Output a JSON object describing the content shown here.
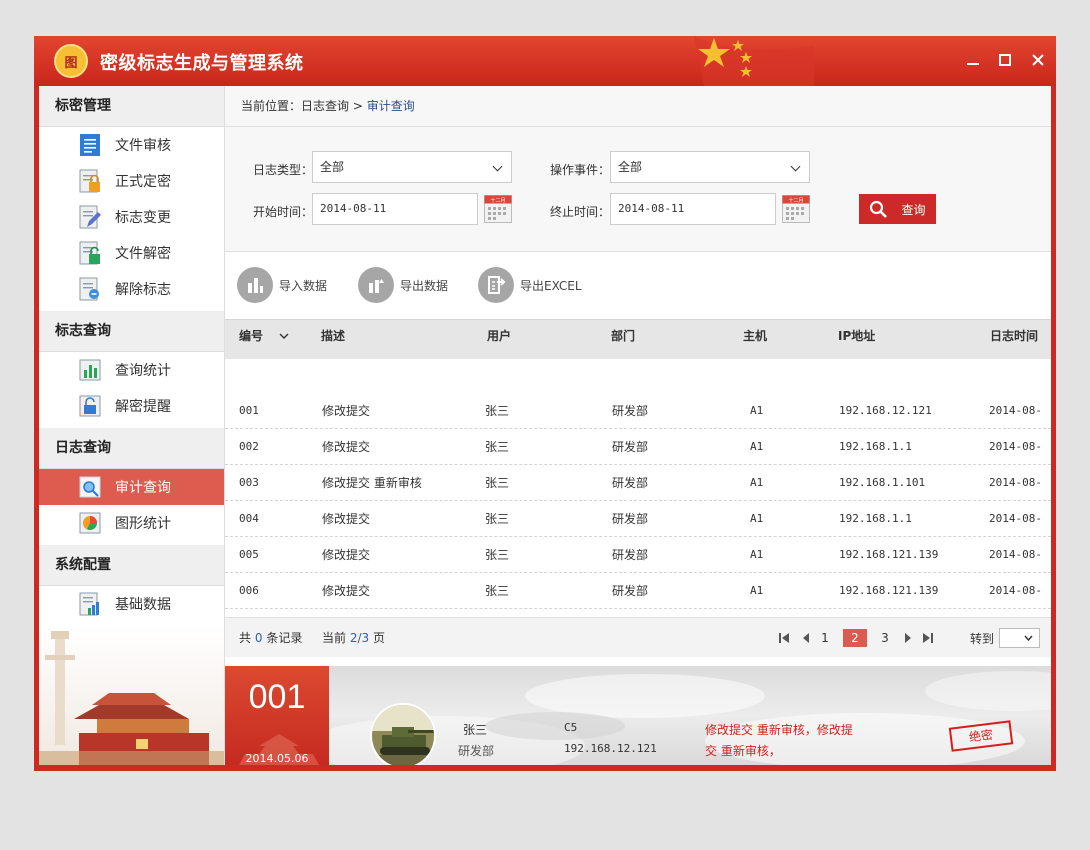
{
  "app": {
    "title": "密级标志生成与管理系统",
    "logo_text": "图"
  },
  "window_controls": {
    "minimize": "—",
    "maximize": "□",
    "close": "✕"
  },
  "sidebar": {
    "groups": [
      {
        "title": "标密管理",
        "items": [
          {
            "label": "文件审核",
            "icon": "document-icon"
          },
          {
            "label": "正式定密",
            "icon": "lock-document-icon"
          },
          {
            "label": "标志变更",
            "icon": "edit-document-icon"
          },
          {
            "label": "文件解密",
            "icon": "unlock-document-icon"
          },
          {
            "label": "解除标志",
            "icon": "remove-mark-icon"
          }
        ]
      },
      {
        "title": "标志查询",
        "items": [
          {
            "label": "查询统计",
            "icon": "bar-chart-icon"
          },
          {
            "label": "解密提醒",
            "icon": "alert-icon"
          }
        ]
      },
      {
        "title": "日志查询",
        "items": [
          {
            "label": "审计查询",
            "icon": "audit-search-icon",
            "active": true
          },
          {
            "label": "图形统计",
            "icon": "pie-chart-icon"
          }
        ]
      },
      {
        "title": "系统配置",
        "items": [
          {
            "label": "基础数据",
            "icon": "data-icon"
          }
        ]
      }
    ]
  },
  "breadcrumb": {
    "prefix": "当前位置：",
    "parent": "日志查询",
    "separator": ">",
    "current": "审计查询"
  },
  "filters": {
    "log_type_label": "日志类型：",
    "log_type_value": "全部",
    "event_label": "操作事件：",
    "event_value": "全部",
    "start_label": "开始时间：",
    "start_value": "2014-08-11",
    "end_label": "终止时间：",
    "end_value": "2014-08-11",
    "query_button": "查询",
    "calendar_text": "十二月"
  },
  "toolbar": {
    "import": "导入数据",
    "export": "导出数据",
    "export_excel": "导出EXCEL"
  },
  "table": {
    "columns": [
      "编号",
      "描述",
      "用户",
      "部门",
      "主机",
      "IP地址",
      "日志时间"
    ],
    "rows": [
      {
        "id": "001",
        "desc": "修改提交",
        "user": "张三",
        "dept": "研发部",
        "host": "A1",
        "ip": "192.168.12.121",
        "time": "2014-08-"
      },
      {
        "id": "002",
        "desc": "修改提交",
        "user": "张三",
        "dept": "研发部",
        "host": "A1",
        "ip": "192.168.1.1",
        "time": "2014-08-"
      },
      {
        "id": "003",
        "desc": "修改提交 重新审核",
        "user": "张三",
        "dept": "研发部",
        "host": "A1",
        "ip": "192.168.1.101",
        "time": "2014-08-"
      },
      {
        "id": "004",
        "desc": "修改提交",
        "user": "张三",
        "dept": "研发部",
        "host": "A1",
        "ip": "192.168.1.1",
        "time": "2014-08-"
      },
      {
        "id": "005",
        "desc": "修改提交",
        "user": "张三",
        "dept": "研发部",
        "host": "A1",
        "ip": "192.168.121.139",
        "time": "2014-08-"
      },
      {
        "id": "006",
        "desc": "修改提交",
        "user": "张三",
        "dept": "研发部",
        "host": "A1",
        "ip": "192.168.121.139",
        "time": "2014-08-"
      }
    ]
  },
  "pager": {
    "total_prefix": "共",
    "total": "0",
    "total_suffix": "条记录",
    "current_prefix": "当前",
    "current": "2/3",
    "current_suffix": "页",
    "pages": [
      "1",
      "2",
      "3"
    ],
    "active_page": "2",
    "goto_label": "转到"
  },
  "detail": {
    "number": "001",
    "date": "2014.05.06",
    "user": "张三",
    "dept": "研发部",
    "host": "C5",
    "ip": "192.168.12.121",
    "action": "修改提交 重新审核，修改提交 重新审核，",
    "stamp": "绝密"
  },
  "colors": {
    "brand_red": "#cc2a20",
    "active_item": "#dd5b4f",
    "link_blue": "#2b5fb0",
    "stamp_red": "#d3201b"
  }
}
